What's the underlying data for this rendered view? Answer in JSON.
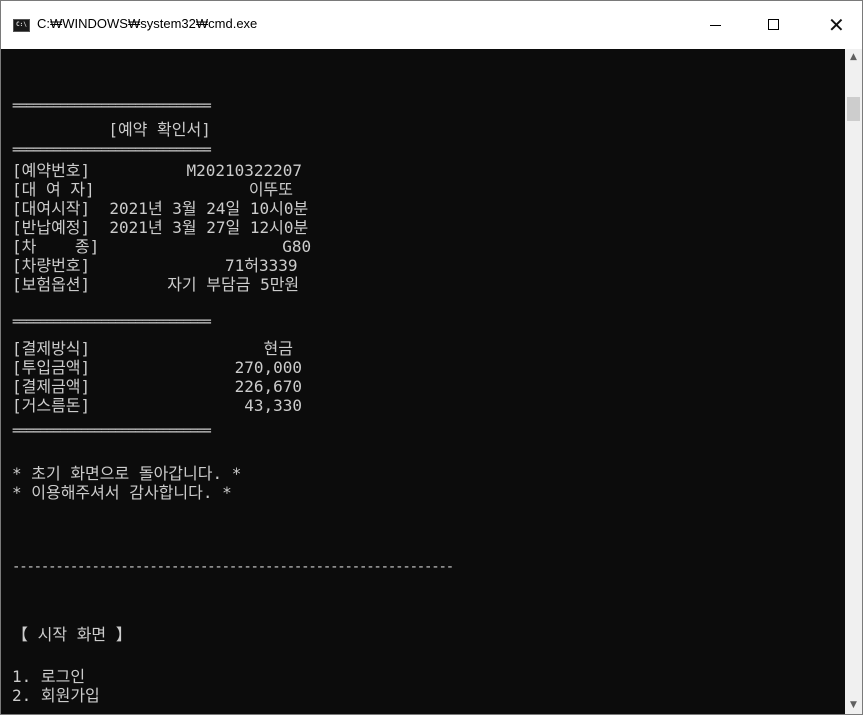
{
  "window": {
    "title": "C:₩WINDOWS₩system32₩cmd.exe",
    "icon": "cmd-icon",
    "controls": {
      "minimize": "minimize-icon",
      "maximize": "maximize-icon",
      "close": "close-icon"
    }
  },
  "console": {
    "lines": [
      "=============================",
      "          [예약 확인서]",
      "=============================",
      "[예약번호]          M20210322207",
      "[대 여 자]                이뚜또",
      "[대여시작]  2021년 3월 24일 10시0분",
      "[반납예정]  2021년 3월 27일 12시0분",
      "[차    종]                   G80",
      "[차량번호]              71허3339",
      "[보험옵션]        자기 부담금 5만원",
      "=============================",
      "[결제방식]                  현금",
      "[투입금액]               270,000",
      "[결제금액]               226,670",
      "[거스름돈]                43,330",
      "=============================",
      "* 초기 화면으로 돌아갑니다. *",
      "* 이용해주셔서 감사합니다. *",
      "-------------------------------------------------------------",
      "【 시작 화면 】",
      "1. 로그인",
      "2. 회원가입"
    ]
  },
  "colors": {
    "console_bg": "#0c0c0c",
    "console_fg": "#cccccc",
    "titlebar_bg": "#ffffff"
  }
}
